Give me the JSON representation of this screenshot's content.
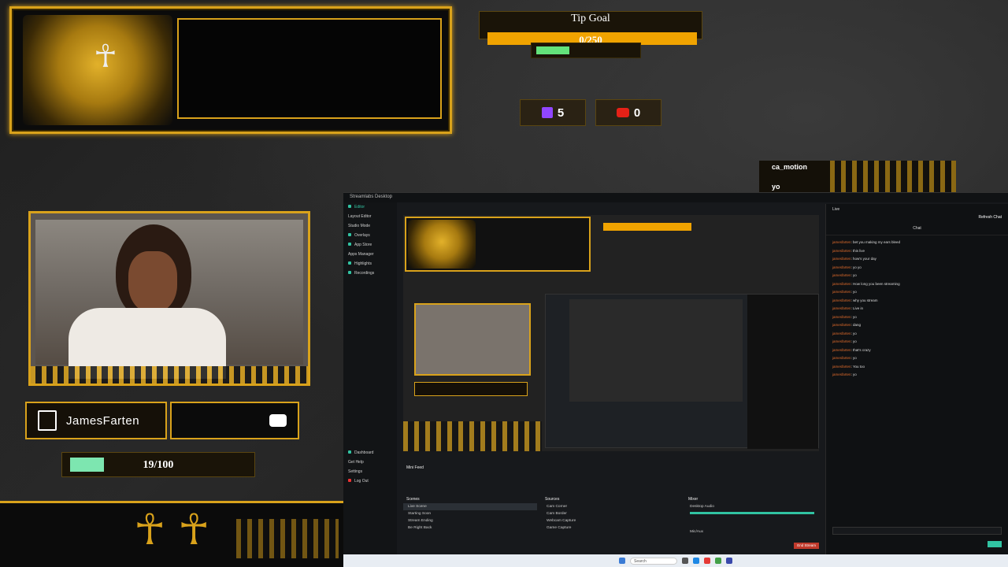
{
  "overlay": {
    "tip_goal": {
      "title": "Tip Goal",
      "value": "0/250"
    },
    "twitch_count": "5",
    "youtube_count": "0",
    "chat_overlay": {
      "user": "ca_motion",
      "message": "yo"
    },
    "streamer_name": "JamesFarten",
    "follow_goal": {
      "value": "19/100",
      "progress": 0.19
    }
  },
  "streamlabs": {
    "title": "Streamlabs Desktop",
    "sidebar": [
      "Editor",
      "Layout Editor",
      "Studio Mode",
      "Overlays",
      "App Store",
      "Apps Manager",
      "Highlights",
      "Recordings"
    ],
    "sidebar_bottom": [
      "Dashboard",
      "Get Help",
      "Settings",
      "Log Out"
    ],
    "chat_header": {
      "channel": "Live",
      "refresh": "Refresh Chat",
      "tab": "Chat"
    },
    "chat": [
      {
        "user": "jamesfarten",
        "msg": "bet you making my ears bleed"
      },
      {
        "user": "jamesfarten",
        "msg": "this live"
      },
      {
        "user": "jamesfarten",
        "msg": "how's your day"
      },
      {
        "user": "jamesfarten",
        "msg": "yo yo"
      },
      {
        "user": "jamesfarten",
        "msg": "yo"
      },
      {
        "user": "jamesfarten",
        "msg": "How long you been streaming"
      },
      {
        "user": "jamesfarten",
        "msg": "yo"
      },
      {
        "user": "jamesfarten",
        "msg": "why you stream"
      },
      {
        "user": "jamesfarten",
        "msg": "Live in"
      },
      {
        "user": "jamesfarten",
        "msg": "yo"
      },
      {
        "user": "jamesfarten",
        "msg": "dang"
      },
      {
        "user": "jamesfarten",
        "msg": "yo"
      },
      {
        "user": "jamesfarten",
        "msg": "yo"
      },
      {
        "user": "jamesfarten",
        "msg": "that's crazy"
      },
      {
        "user": "jamesfarten",
        "msg": "yo"
      },
      {
        "user": "jamesfarten",
        "msg": "You too"
      },
      {
        "user": "jamesfarten",
        "msg": "yo"
      }
    ],
    "mini_feed": {
      "title": "Mini Feed"
    },
    "scenes": {
      "title": "Scenes",
      "items": [
        "Live Scene",
        "Starting Soon",
        "Stream Ending",
        "Be Right Back"
      ]
    },
    "sources": {
      "title": "Sources",
      "items": [
        "Cam Corner",
        "Cam Border",
        "Webcam Capture",
        "Game Capture"
      ]
    },
    "mixer": {
      "title": "Mixer",
      "items": [
        "Desktop Audio",
        "Mic/Aux"
      ]
    },
    "end_stream": "End Stream"
  },
  "taskbar": {
    "search": "Search"
  }
}
